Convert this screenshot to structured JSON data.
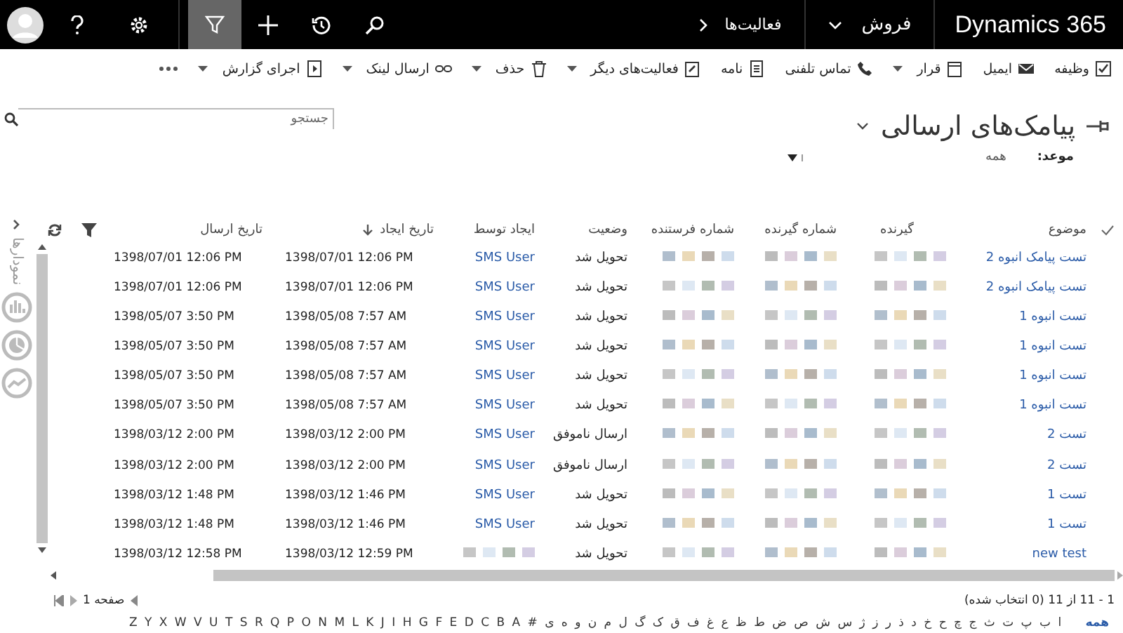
{
  "nav": {
    "brand": "Dynamics 365",
    "area": "فروش",
    "section": "فعالیت‌ها",
    "tools": [
      {
        "kind": "search",
        "selected": false
      },
      {
        "kind": "history",
        "selected": false
      },
      {
        "kind": "plus",
        "selected": false
      },
      {
        "kind": "filter",
        "selected": true
      }
    ]
  },
  "toolbar": [
    {
      "label": "وظیفه",
      "dropdown": false
    },
    {
      "label": "ایمیل",
      "dropdown": false
    },
    {
      "label": "قرار",
      "dropdown": true
    },
    {
      "label": "تماس تلفنی",
      "dropdown": false
    },
    {
      "label": "نامه",
      "dropdown": false
    },
    {
      "label": "فعالیت‌های دیگر",
      "dropdown": true
    },
    {
      "label": "حذف",
      "dropdown": true
    },
    {
      "label": "ارسال لینک",
      "dropdown": true
    },
    {
      "label": "اجرای گزارش",
      "dropdown": true
    }
  ],
  "view": {
    "title": "پیامک‌های ارسالی",
    "filter_label": "موعد:",
    "filter_value": "همه"
  },
  "search": {
    "placeholder": "جستجو"
  },
  "table": {
    "columns": [
      "موضوع",
      "گیرنده",
      "شماره گیرنده",
      "شماره فرستنده",
      "وضعیت",
      "ایجاد توسط",
      "تاریخ ایجاد",
      "تاریخ ارسال"
    ],
    "rows": [
      {
        "subject": "تست پیامک انبوه 2",
        "status": "تحویل شد",
        "created_by": "SMS User",
        "created_on": "1398/07/01 12:06 PM",
        "sent_on": "1398/07/01 12:06 PM"
      },
      {
        "subject": "تست پیامک انبوه 2",
        "status": "تحویل شد",
        "created_by": "SMS User",
        "created_on": "1398/07/01 12:06 PM",
        "sent_on": "1398/07/01 12:06 PM"
      },
      {
        "subject": "تست انبوه 1",
        "status": "تحویل شد",
        "created_by": "SMS User",
        "created_on": "1398/05/08 7:57 AM",
        "sent_on": "1398/05/07 3:50 PM"
      },
      {
        "subject": "تست انبوه 1",
        "status": "تحویل شد",
        "created_by": "SMS User",
        "created_on": "1398/05/08 7:57 AM",
        "sent_on": "1398/05/07 3:50 PM"
      },
      {
        "subject": "تست انبوه 1",
        "status": "تحویل شد",
        "created_by": "SMS User",
        "created_on": "1398/05/08 7:57 AM",
        "sent_on": "1398/05/07 3:50 PM"
      },
      {
        "subject": "تست انبوه 1",
        "status": "تحویل شد",
        "created_by": "SMS User",
        "created_on": "1398/05/08 7:57 AM",
        "sent_on": "1398/05/07 3:50 PM"
      },
      {
        "subject": "تست 2",
        "status": "ارسال ناموفق",
        "created_by": "SMS User",
        "created_on": "1398/03/12 2:00 PM",
        "sent_on": "1398/03/12 2:00 PM"
      },
      {
        "subject": "تست 2",
        "status": "ارسال ناموفق",
        "created_by": "SMS User",
        "created_on": "1398/03/12 2:00 PM",
        "sent_on": "1398/03/12 2:00 PM"
      },
      {
        "subject": "تست 1",
        "status": "تحویل شد",
        "created_by": "SMS User",
        "created_on": "1398/03/12 1:46 PM",
        "sent_on": "1398/03/12 1:48 PM"
      },
      {
        "subject": "تست 1",
        "status": "تحویل شد",
        "created_by": "SMS User",
        "created_on": "1398/03/12 1:46 PM",
        "sent_on": "1398/03/12 1:48 PM"
      },
      {
        "subject": "new test",
        "status": "تحویل شد",
        "created_on": "1398/03/12 12:59 PM",
        "sent_on": "1398/03/12 12:58 PM"
      }
    ]
  },
  "charts_panel": {
    "label": "نمودارها"
  },
  "footer": {
    "count": "1 - 11 از 11 (0 انتخاب شده)",
    "page": "صفحه 1"
  },
  "alphabet": [
    {
      "letter": "همه",
      "selected": true
    },
    {
      "letter": "ا",
      "selected": false
    },
    {
      "letter": "ب",
      "selected": false
    },
    {
      "letter": "پ",
      "selected": false
    },
    {
      "letter": "ت",
      "selected": false
    },
    {
      "letter": "ث",
      "selected": false
    },
    {
      "letter": "ج",
      "selected": false
    },
    {
      "letter": "چ",
      "selected": false
    },
    {
      "letter": "ح",
      "selected": false
    },
    {
      "letter": "خ",
      "selected": false
    },
    {
      "letter": "د",
      "selected": false
    },
    {
      "letter": "ذ",
      "selected": false
    },
    {
      "letter": "ر",
      "selected": false
    },
    {
      "letter": "ز",
      "selected": false
    },
    {
      "letter": "ژ",
      "selected": false
    },
    {
      "letter": "س",
      "selected": false
    },
    {
      "letter": "ش",
      "selected": false
    },
    {
      "letter": "ص",
      "selected": false
    },
    {
      "letter": "ض",
      "selected": false
    },
    {
      "letter": "ط",
      "selected": false
    },
    {
      "letter": "ظ",
      "selected": false
    },
    {
      "letter": "ع",
      "selected": false
    },
    {
      "letter": "غ",
      "selected": false
    },
    {
      "letter": "ف",
      "selected": false
    },
    {
      "letter": "ق",
      "selected": false
    },
    {
      "letter": "ک",
      "selected": false
    },
    {
      "letter": "گ",
      "selected": false
    },
    {
      "letter": "ل",
      "selected": false
    },
    {
      "letter": "م",
      "selected": false
    },
    {
      "letter": "ن",
      "selected": false
    },
    {
      "letter": "و",
      "selected": false
    },
    {
      "letter": "ه",
      "selected": false
    },
    {
      "letter": "ی",
      "selected": false
    },
    {
      "letter": "#",
      "selected": false
    },
    {
      "letter": "A",
      "selected": false
    },
    {
      "letter": "B",
      "selected": false
    },
    {
      "letter": "C",
      "selected": false
    },
    {
      "letter": "D",
      "selected": false
    },
    {
      "letter": "E",
      "selected": false
    },
    {
      "letter": "F",
      "selected": false
    },
    {
      "letter": "G",
      "selected": false
    },
    {
      "letter": "H",
      "selected": false
    },
    {
      "letter": "I",
      "selected": false
    },
    {
      "letter": "J",
      "selected": false
    },
    {
      "letter": "K",
      "selected": false
    },
    {
      "letter": "L",
      "selected": false
    },
    {
      "letter": "M",
      "selected": false
    },
    {
      "letter": "N",
      "selected": false
    },
    {
      "letter": "O",
      "selected": false
    },
    {
      "letter": "P",
      "selected": false
    },
    {
      "letter": "Q",
      "selected": false
    },
    {
      "letter": "R",
      "selected": false
    },
    {
      "letter": "S",
      "selected": false
    },
    {
      "letter": "T",
      "selected": false
    },
    {
      "letter": "U",
      "selected": false
    },
    {
      "letter": "V",
      "selected": false
    },
    {
      "letter": "W",
      "selected": false
    },
    {
      "letter": "X",
      "selected": false
    },
    {
      "letter": "Y",
      "selected": false
    },
    {
      "letter": "Z",
      "selected": false
    }
  ]
}
